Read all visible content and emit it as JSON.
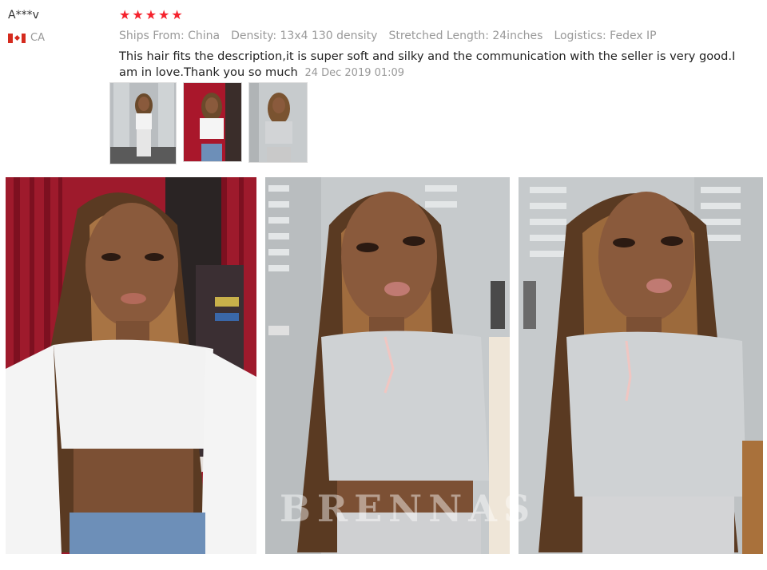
{
  "reviewer": {
    "name": "A***v",
    "country_code": "CA"
  },
  "review": {
    "stars": 5,
    "star_color": "#f5222d",
    "attributes": [
      "Ships From: China",
      "Density: 13x4 130 density",
      "Stretched Length: 24inches",
      "Logistics: Fedex IP"
    ],
    "text": "This hair fits the description,it is super soft and silky and the communication with the seller is very good.I am in love.Thank you so much",
    "date": "24 Dec 2019 01:09"
  },
  "watermark": "BRENNAS"
}
